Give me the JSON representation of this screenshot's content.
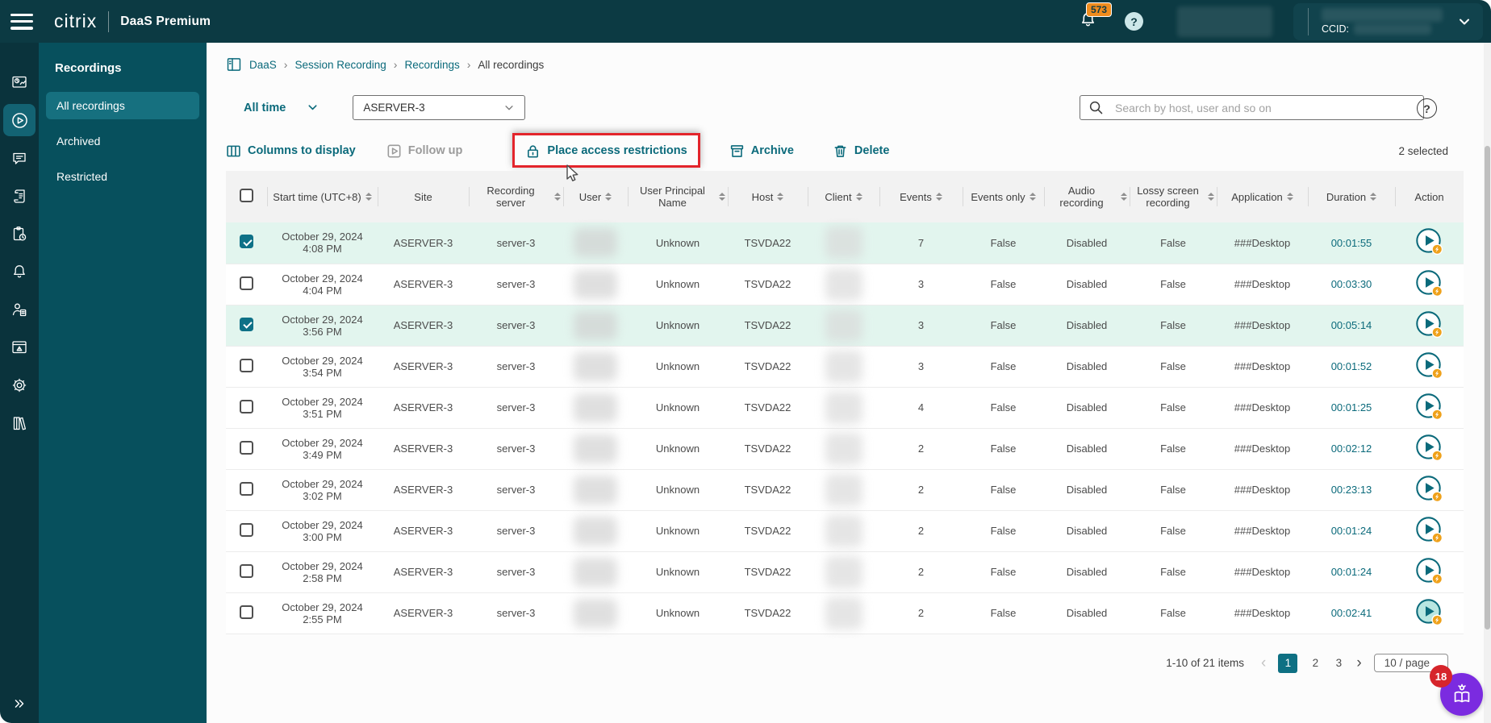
{
  "header": {
    "brand": "citrix",
    "product": "DaaS Premium",
    "notification_count": "573",
    "help_label": "?",
    "ccid_label": "CCID:"
  },
  "nav_rail": {
    "items": [
      {
        "icon": "analytics-dashboard-icon",
        "active": false
      },
      {
        "icon": "recordings-play-icon",
        "active": true
      },
      {
        "icon": "messages-icon",
        "active": false
      },
      {
        "icon": "session-log-icon",
        "active": false
      },
      {
        "icon": "scheduled-tasks-icon",
        "active": false
      },
      {
        "icon": "notifications-bell-icon",
        "active": false
      },
      {
        "icon": "user-activity-icon",
        "active": false
      },
      {
        "icon": "site-alert-icon",
        "active": false
      },
      {
        "icon": "settings-gear-icon",
        "active": false
      },
      {
        "icon": "library-icon",
        "active": false
      }
    ],
    "expand": "collapse-expand-chevrons"
  },
  "sidebar": {
    "title": "Recordings",
    "items": [
      {
        "label": "All recordings",
        "active": true
      },
      {
        "label": "Archived",
        "active": false
      },
      {
        "label": "Restricted",
        "active": false
      }
    ]
  },
  "breadcrumb": {
    "separator": "›",
    "items": [
      "DaaS",
      "Session Recording",
      "Recordings",
      "All recordings"
    ]
  },
  "filters": {
    "time_range": "All time",
    "server": "ASERVER-3"
  },
  "search": {
    "placeholder": "Search by host, user and so on"
  },
  "toolbar": {
    "columns": "Columns to display",
    "follow_up": "Follow up",
    "place_access_restrictions": "Place access restrictions",
    "archive": "Archive",
    "delete": "Delete",
    "selected_count": "2 selected"
  },
  "table": {
    "columns": [
      "Start time (UTC+8)",
      "Site",
      "Recording server",
      "User",
      "User Principal Name",
      "Host",
      "Client",
      "Events",
      "Events only",
      "Audio recording",
      "Lossy screen recording",
      "Application",
      "Duration",
      "Action"
    ],
    "rows": [
      {
        "checked": true,
        "start": "October 29, 2024 4:08 PM",
        "site": "ASERVER-3",
        "server": "server-3",
        "upn": "Unknown",
        "host": "TSVDA22",
        "events": "7",
        "events_only": "False",
        "audio": "Disabled",
        "lossy": "False",
        "app": "###Desktop",
        "duration": "00:01:55"
      },
      {
        "checked": false,
        "start": "October 29, 2024 4:04 PM",
        "site": "ASERVER-3",
        "server": "server-3",
        "upn": "Unknown",
        "host": "TSVDA22",
        "events": "3",
        "events_only": "False",
        "audio": "Disabled",
        "lossy": "False",
        "app": "###Desktop",
        "duration": "00:03:30"
      },
      {
        "checked": true,
        "start": "October 29, 2024 3:56 PM",
        "site": "ASERVER-3",
        "server": "server-3",
        "upn": "Unknown",
        "host": "TSVDA22",
        "events": "3",
        "events_only": "False",
        "audio": "Disabled",
        "lossy": "False",
        "app": "###Desktop",
        "duration": "00:05:14"
      },
      {
        "checked": false,
        "start": "October 29, 2024 3:54 PM",
        "site": "ASERVER-3",
        "server": "server-3",
        "upn": "Unknown",
        "host": "TSVDA22",
        "events": "3",
        "events_only": "False",
        "audio": "Disabled",
        "lossy": "False",
        "app": "###Desktop",
        "duration": "00:01:52"
      },
      {
        "checked": false,
        "start": "October 29, 2024 3:51 PM",
        "site": "ASERVER-3",
        "server": "server-3",
        "upn": "Unknown",
        "host": "TSVDA22",
        "events": "4",
        "events_only": "False",
        "audio": "Disabled",
        "lossy": "False",
        "app": "###Desktop",
        "duration": "00:01:25"
      },
      {
        "checked": false,
        "start": "October 29, 2024 3:49 PM",
        "site": "ASERVER-3",
        "server": "server-3",
        "upn": "Unknown",
        "host": "TSVDA22",
        "events": "2",
        "events_only": "False",
        "audio": "Disabled",
        "lossy": "False",
        "app": "###Desktop",
        "duration": "00:02:12"
      },
      {
        "checked": false,
        "start": "October 29, 2024 3:02 PM",
        "site": "ASERVER-3",
        "server": "server-3",
        "upn": "Unknown",
        "host": "TSVDA22",
        "events": "2",
        "events_only": "False",
        "audio": "Disabled",
        "lossy": "False",
        "app": "###Desktop",
        "duration": "00:23:13"
      },
      {
        "checked": false,
        "start": "October 29, 2024 3:00 PM",
        "site": "ASERVER-3",
        "server": "server-3",
        "upn": "Unknown",
        "host": "TSVDA22",
        "events": "2",
        "events_only": "False",
        "audio": "Disabled",
        "lossy": "False",
        "app": "###Desktop",
        "duration": "00:01:24"
      },
      {
        "checked": false,
        "start": "October 29, 2024 2:58 PM",
        "site": "ASERVER-3",
        "server": "server-3",
        "upn": "Unknown",
        "host": "TSVDA22",
        "events": "2",
        "events_only": "False",
        "audio": "Disabled",
        "lossy": "False",
        "app": "###Desktop",
        "duration": "00:01:24"
      },
      {
        "checked": false,
        "start": "October 29, 2024 2:55 PM",
        "site": "ASERVER-3",
        "server": "server-3",
        "upn": "Unknown",
        "host": "TSVDA22",
        "events": "2",
        "events_only": "False",
        "audio": "Disabled",
        "lossy": "False",
        "app": "###Desktop",
        "duration": "00:02:41"
      }
    ]
  },
  "pagination": {
    "summary": "1-10 of 21 items",
    "prev": "‹",
    "next": "›",
    "pages": [
      "1",
      "2",
      "3"
    ],
    "current": "1",
    "page_size": "10 / page"
  },
  "assistant": {
    "badge": "18"
  },
  "colors": {
    "header_bg": "#0c3a43",
    "rail_bg": "#0a333c",
    "panel_bg": "#07505d",
    "accent_teal": "#0b6a7b",
    "selected_row": "#e2f5ee",
    "annotation_red": "#e3242b",
    "notification_orange": "#ef8c1d",
    "assistant_purple": "#7b2be0",
    "badge_red": "#d6252b"
  }
}
